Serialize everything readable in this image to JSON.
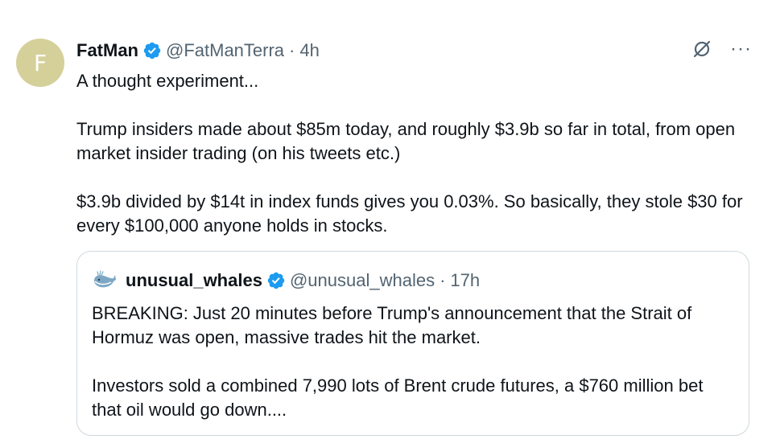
{
  "tweet": {
    "avatar_letter": "F",
    "author_name": "FatMan",
    "handle": "@FatManTerra",
    "separator": "·",
    "time": "4h",
    "more_label": "···",
    "paragraphs": [
      "A thought experiment...",
      "Trump insiders made about $85m today, and roughly $3.9b so far in total, from open market insider trading (on his tweets etc.)",
      "$3.9b divided by $14t in index funds gives you 0.03%. So basically, they stole $30 for every $100,000 anyone holds in stocks."
    ]
  },
  "quote": {
    "author_name": "unusual_whales",
    "handle": "@unusual_whales",
    "separator": "·",
    "time": "17h",
    "paragraphs": [
      "BREAKING: Just 20 minutes before Trump's announcement that the Strait of Hormuz was open, massive trades hit the market.",
      "Investors sold a combined 7,990 lots of Brent crude futures, a $760 million bet that oil would go down...."
    ]
  },
  "colors": {
    "verified_blue": "#1d9bf0",
    "secondary_text": "#536471",
    "border": "#cfd9de",
    "avatar_bg": "#d5d09a"
  },
  "icons": {
    "verified": "verified-badge-icon",
    "grok": "grok-icon",
    "more": "more-icon",
    "whale": "whale-icon"
  }
}
